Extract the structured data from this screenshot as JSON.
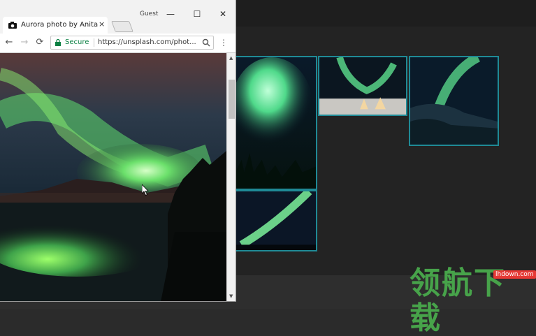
{
  "window": {
    "user": "Guest",
    "minimize": "—",
    "maximize": "☐",
    "close": "✕"
  },
  "tab": {
    "title": "Aurora photo by Anita Sh",
    "close": "×"
  },
  "toolbar": {
    "back": "←",
    "forward": "→",
    "reload": "⟳",
    "secure_label": "Secure",
    "url": "https://unsplash.com/phot...",
    "menu": "⋮"
  },
  "watermark": {
    "text": "领航下载",
    "site": "lhdown.com"
  },
  "colors": {
    "accent_border": "#1f8a96",
    "secure": "#0b8043",
    "aurora": "#4dff7a"
  },
  "icons": [
    "camera-icon",
    "lock-icon",
    "search-icon",
    "menu-icon",
    "back-icon",
    "forward-icon",
    "reload-icon"
  ]
}
